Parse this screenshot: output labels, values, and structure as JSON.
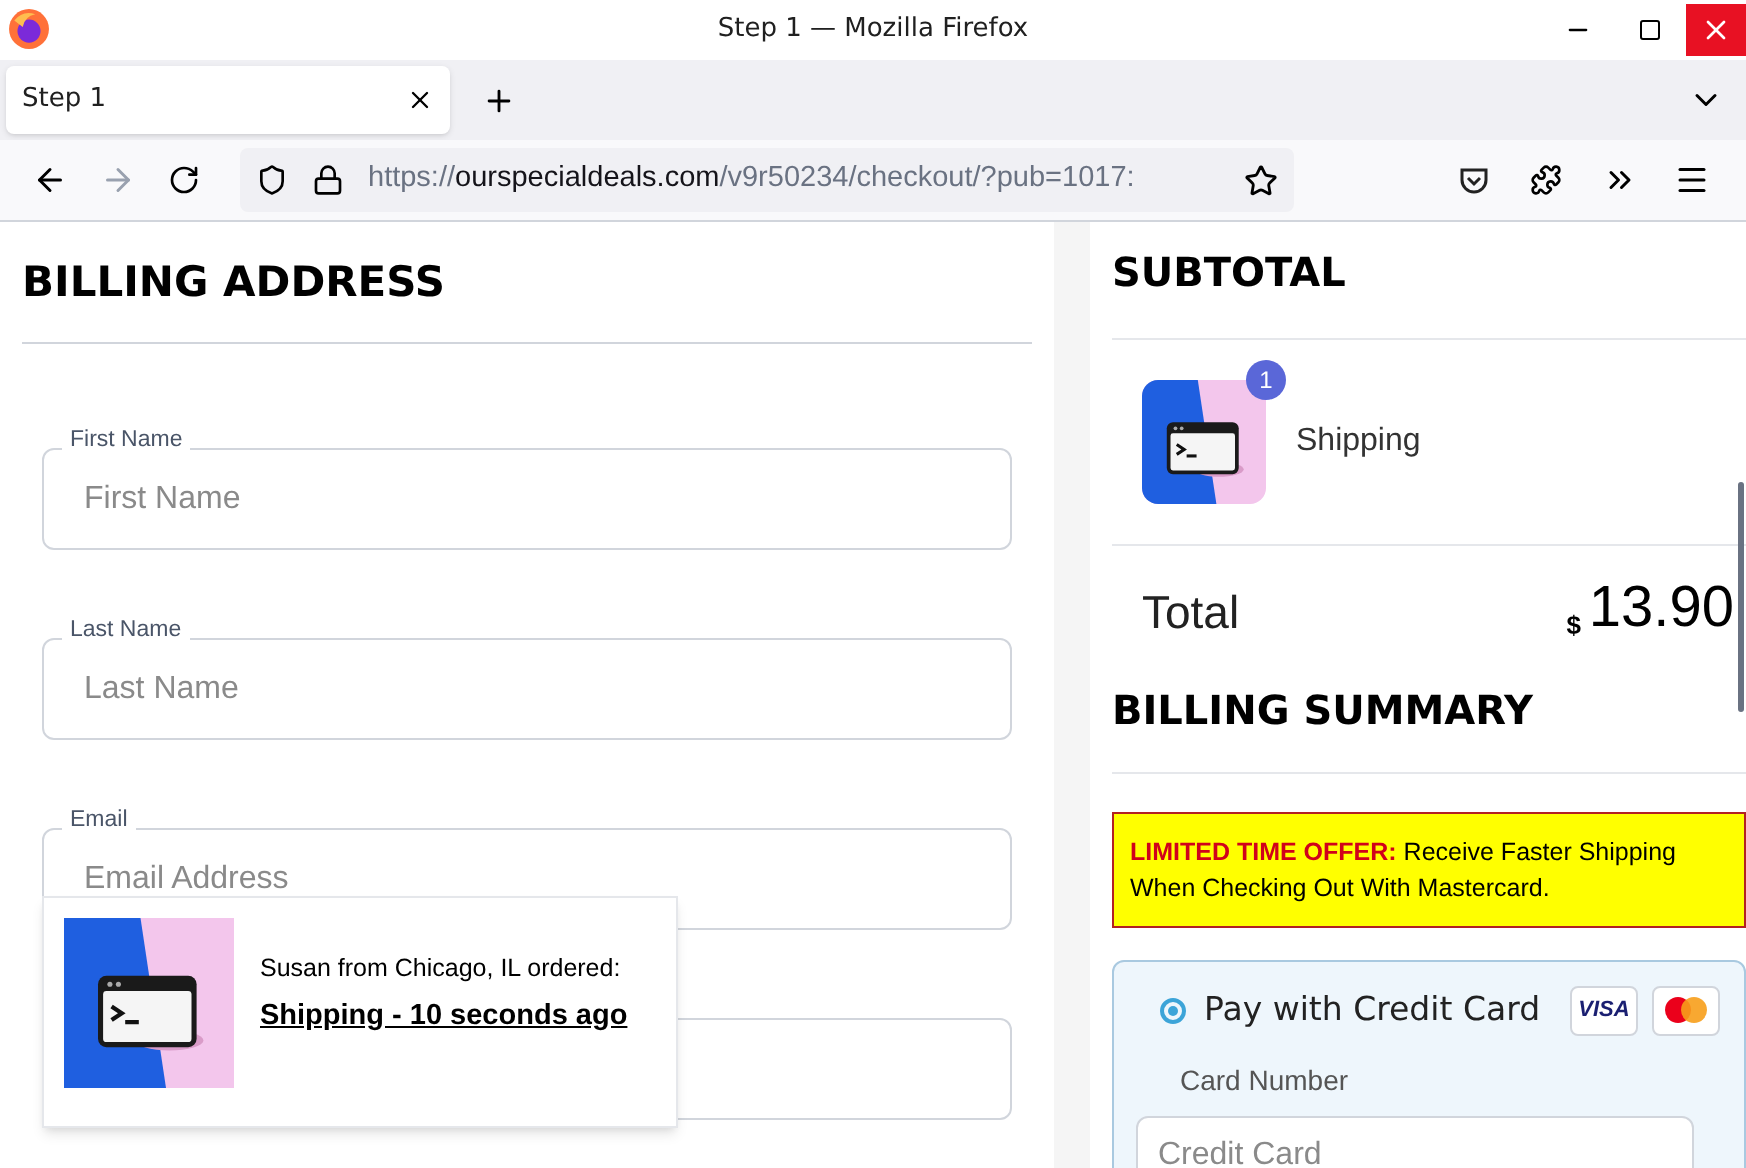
{
  "window": {
    "title": "Step 1 — Mozilla Firefox"
  },
  "tabs": [
    {
      "label": "Step 1",
      "selected": true
    }
  ],
  "url": {
    "scheme": "https://",
    "domain": "ourspecialdeals.com",
    "path": "/v9r50234/checkout/?pub=1017:"
  },
  "billing_address": {
    "heading": "BILLING ADDRESS",
    "fields": [
      {
        "kind": "labeled",
        "label": "First Name",
        "placeholder": "First Name"
      },
      {
        "kind": "labeled",
        "label": "Last Name",
        "placeholder": "Last Name"
      },
      {
        "kind": "labeled",
        "label": "Email",
        "placeholder": "Email Address"
      },
      {
        "kind": "bare"
      }
    ]
  },
  "toast": {
    "text": "Susan from Chicago, IL ordered:",
    "link": "Shipping - 10 seconds ago"
  },
  "subtotal": {
    "heading": "SUBTOTAL",
    "items": [
      {
        "name": "Shipping",
        "quantity": "1"
      }
    ],
    "total_label": "Total",
    "currency": "$",
    "total": "13.90"
  },
  "billing_summary": {
    "heading": "BILLING SUMMARY",
    "offer": "**LIMITED TIME OFFER:** Receive Faster Shipping When Checking Out With Mastercard.",
    "payment_option": {
      "label": "Pay with Credit Card",
      "selected": true,
      "card_logos": [
        {
          "kind": "visa",
          "text": "VISA"
        },
        {
          "kind": "mastercard"
        }
      ],
      "card_number_label": "Card Number",
      "card_number_placeholder": "Credit Card"
    }
  }
}
